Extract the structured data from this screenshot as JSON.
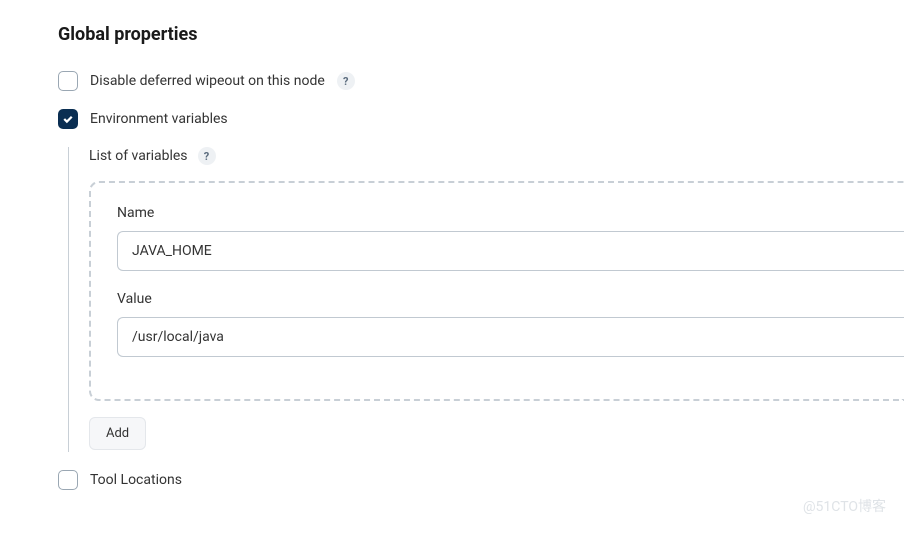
{
  "section": {
    "title": "Global properties"
  },
  "options": {
    "disable_wipeout": {
      "label": "Disable deferred wipeout on this node",
      "checked": false
    },
    "env_vars": {
      "label": "Environment variables",
      "checked": true,
      "sub_label": "List of variables",
      "fields": {
        "name_label": "Name",
        "name_value": "JAVA_HOME",
        "value_label": "Value",
        "value_value": "/usr/local/java"
      },
      "add_button_label": "Add"
    },
    "tool_locations": {
      "label": "Tool Locations",
      "checked": false
    }
  },
  "help_glyph": "?",
  "watermark": "@51CTO博客"
}
